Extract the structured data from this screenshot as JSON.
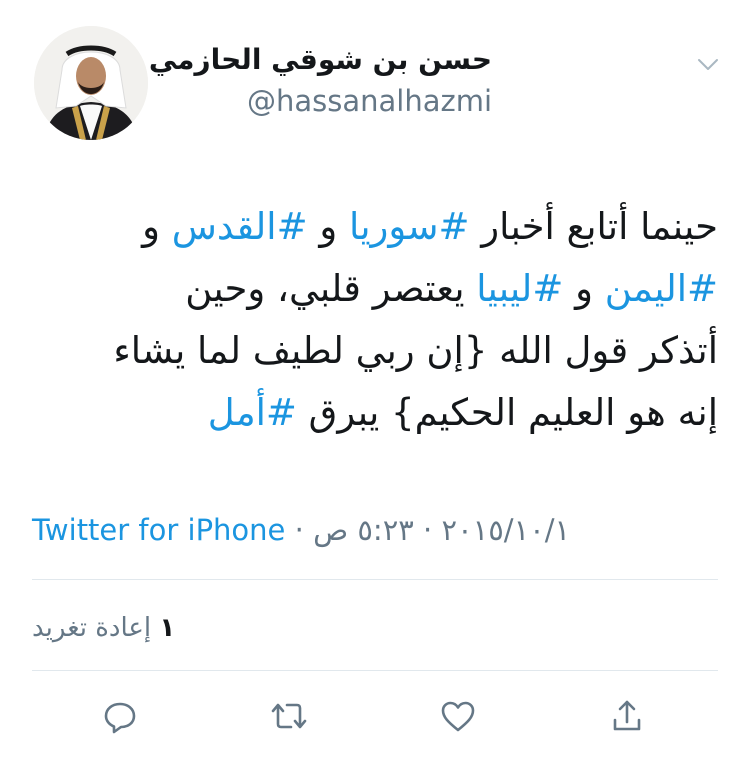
{
  "header": {
    "display_name": "حسن بن شوقي الحازمي",
    "username": "@hassanalhazmi",
    "menu_icon": "chevron-down-icon",
    "avatar_icon": "avatar-photo"
  },
  "tweet": {
    "lines": [
      [
        {
          "text": "حينما أتابع أخبار ",
          "hashtag": false
        },
        {
          "text": "#سوريا",
          "hashtag": true
        },
        {
          "text": " و ",
          "hashtag": false
        },
        {
          "text": "#القدس",
          "hashtag": true
        },
        {
          "text": " و",
          "hashtag": false
        }
      ],
      [
        {
          "text": "#اليمن",
          "hashtag": true
        },
        {
          "text": " و ",
          "hashtag": false
        },
        {
          "text": "#ليبيا",
          "hashtag": true
        },
        {
          "text": " يعتصر قلبي، وحين",
          "hashtag": false
        }
      ],
      [
        {
          "text": "أتذكر قول الله {إن ربي لطيف لما يشاء",
          "hashtag": false
        }
      ],
      [
        {
          "text": "إنه هو العليم الحكيم} يبرق ",
          "hashtag": false
        },
        {
          "text": "#أمل",
          "hashtag": true
        }
      ]
    ]
  },
  "meta": {
    "source": "Twitter for iPhone",
    "separator": " · ",
    "date": "٢٠١٥/١٠/١",
    "time": "٥:٢٣ ص"
  },
  "stats": {
    "retweet_count": "١",
    "retweet_label": "إعادة تغريد"
  },
  "actions": {
    "reply_icon": "reply-icon",
    "retweet_icon": "retweet-icon",
    "like_icon": "heart-icon",
    "share_icon": "share-icon"
  },
  "colors": {
    "link": "#1b95e0",
    "text": "#14171a",
    "muted": "#657786",
    "divider": "#e1e8ed"
  }
}
